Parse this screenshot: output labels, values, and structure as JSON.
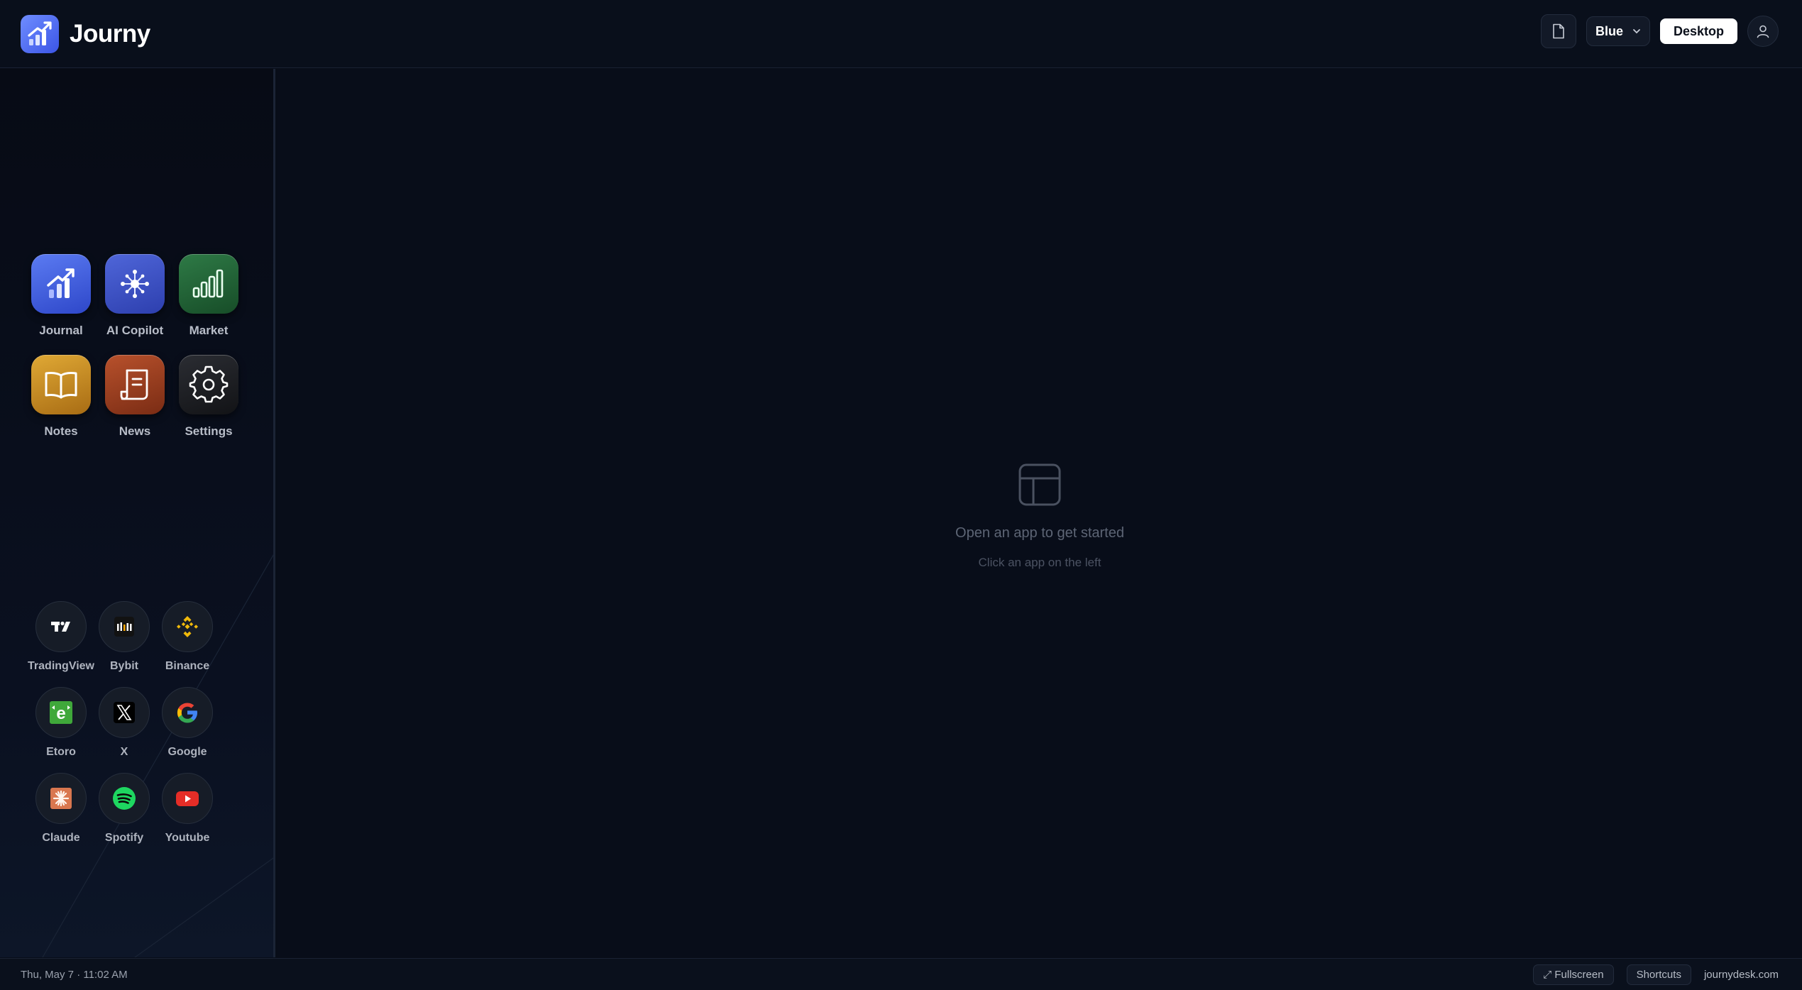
{
  "brand": {
    "name": "Journy",
    "logo_icon": "trend-chart-icon"
  },
  "header": {
    "document_icon": "document-icon",
    "theme_select": {
      "value": "Blue",
      "icon": "chevron-down-icon"
    },
    "mode_button": "Desktop",
    "user_icon": "user-icon"
  },
  "apps": [
    {
      "label": "Journal",
      "icon": "journal-chart-icon",
      "color": "#4a66e0"
    },
    {
      "label": "AI Copilot",
      "icon": "ai-network-icon",
      "color": "#3f55c7"
    },
    {
      "label": "Market",
      "icon": "market-bars-icon",
      "color": "#256238"
    },
    {
      "label": "Notes",
      "icon": "book-icon",
      "color": "#c98c24"
    },
    {
      "label": "News",
      "icon": "newspaper-icon",
      "color": "#9c4020"
    },
    {
      "label": "Settings",
      "icon": "gear-icon",
      "color": "#1e2024"
    }
  ],
  "links": [
    {
      "label": "TradingView",
      "icon": "tradingview-icon"
    },
    {
      "label": "Bybit",
      "icon": "bybit-icon"
    },
    {
      "label": "Binance",
      "icon": "binance-icon",
      "color": "#f0b90b"
    },
    {
      "label": "Etoro",
      "icon": "etoro-icon",
      "color": "#3fa83a"
    },
    {
      "label": "X",
      "icon": "x-logo-icon"
    },
    {
      "label": "Google",
      "icon": "google-icon"
    },
    {
      "label": "Claude",
      "icon": "claude-icon",
      "color": "#d9774f"
    },
    {
      "label": "Spotify",
      "icon": "spotify-icon",
      "color": "#1ed760"
    },
    {
      "label": "Youtube",
      "icon": "youtube-icon",
      "color": "#e52d27"
    }
  ],
  "empty_state": {
    "icon": "layout-panel-icon",
    "title": "Open an app to get started",
    "subtitle": "Click an app on the left"
  },
  "footer": {
    "datetime": "Thu, May 7 · 11:02 AM",
    "fullscreen": "⤢ Fullscreen",
    "shortcuts": "Shortcuts",
    "domain": "journydesk.com"
  }
}
